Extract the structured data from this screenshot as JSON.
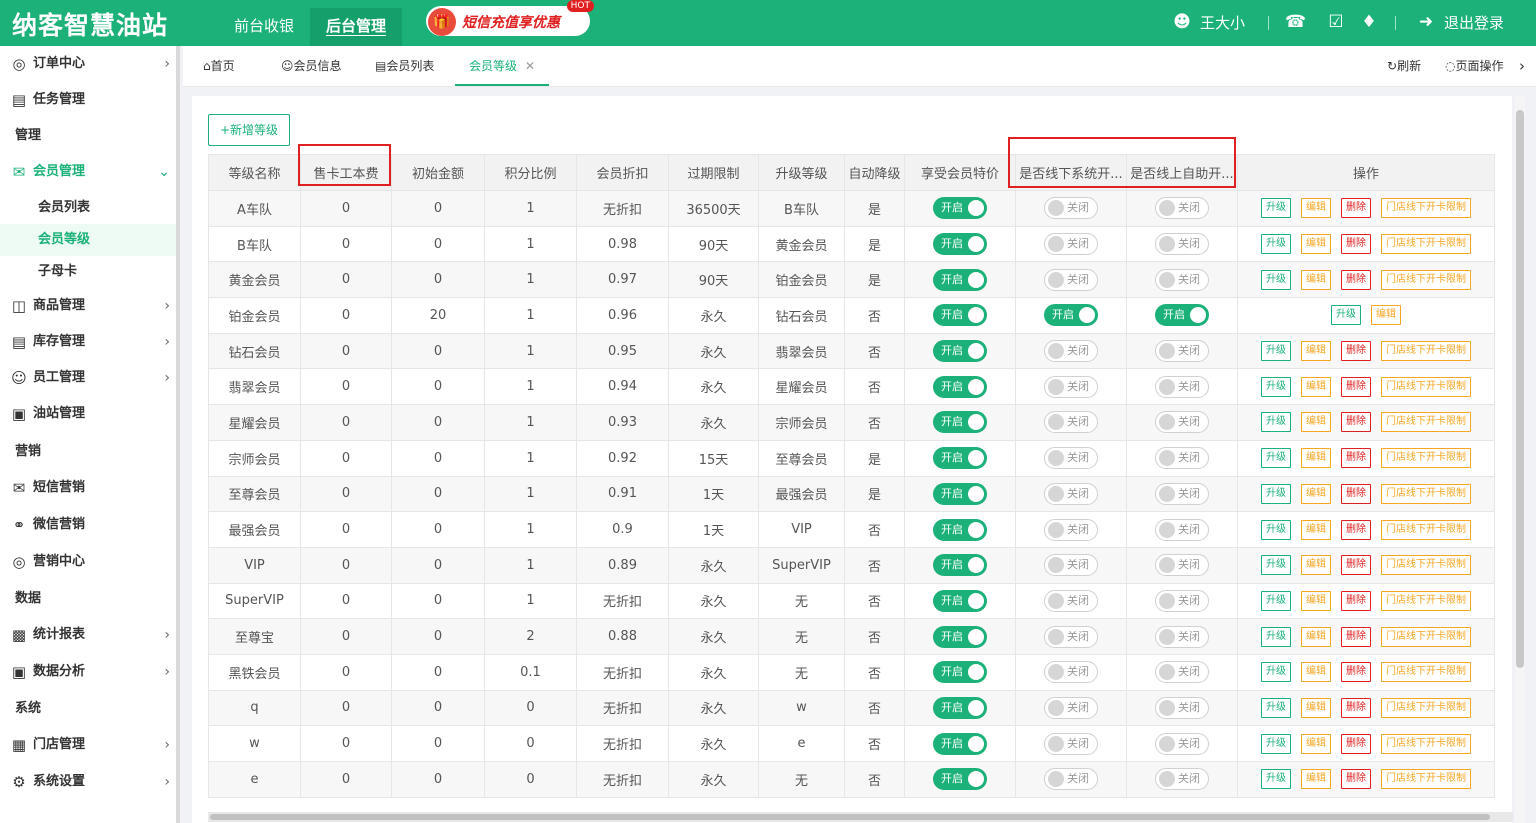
{
  "header": {
    "logo": "纳客智慧油站",
    "nav": [
      "前台收银",
      "后台管理"
    ],
    "promo": "短信充值享优惠",
    "promo_badge": "HOT",
    "user": "王大小",
    "logout": "退出登录"
  },
  "sidebar": {
    "items": [
      {
        "label": "订单中心",
        "icon": "globe-icon"
      },
      {
        "label": "任务管理",
        "icon": "task-icon"
      },
      {
        "label": "管理",
        "section": true
      },
      {
        "label": "会员管理",
        "icon": "member-icon"
      },
      {
        "label": "会员列表",
        "sub": true
      },
      {
        "label": "会员等级",
        "sub": true
      },
      {
        "label": "子母卡",
        "sub": true
      },
      {
        "label": "商品管理",
        "icon": "goods-icon"
      },
      {
        "label": "库存管理",
        "icon": "stock-icon"
      },
      {
        "label": "员工管理",
        "icon": "staff-icon"
      },
      {
        "label": "油站管理",
        "icon": "station-icon"
      },
      {
        "label": "营销",
        "section": true
      },
      {
        "label": "短信营销",
        "icon": "mail-icon"
      },
      {
        "label": "微信营销",
        "icon": "wechat-icon"
      },
      {
        "label": "营销中心",
        "icon": "target-icon"
      },
      {
        "label": "数据",
        "section": true
      },
      {
        "label": "统计报表",
        "icon": "report-icon"
      },
      {
        "label": "数据分析",
        "icon": "analysis-icon"
      },
      {
        "label": "系统",
        "section": true
      },
      {
        "label": "门店管理",
        "icon": "store-icon"
      },
      {
        "label": "系统设置",
        "icon": "settings-icon"
      }
    ]
  },
  "tabs": {
    "items": [
      "首页",
      "会员信息",
      "会员列表",
      "会员等级"
    ],
    "refresh": "刷新",
    "page_ops": "页面操作"
  },
  "toolbar": {
    "add_label": "+新增等级"
  },
  "table": {
    "headers": [
      "等级名称",
      "售卡工本费",
      "初始金额",
      "积分比例",
      "会员折扣",
      "过期限制",
      "升级等级",
      "自动降级",
      "享受会员特价",
      "是否线下系统开...",
      "是否线上自助开...",
      "操作"
    ],
    "rows": [
      [
        "A车队",
        "0",
        "0",
        "1",
        "无折扣",
        "36500天",
        "B车队",
        "是",
        "开启",
        "关闭",
        "关闭"
      ],
      [
        "B车队",
        "0",
        "0",
        "1",
        "0.98",
        "90天",
        "黄金会员",
        "是",
        "开启",
        "关闭",
        "关闭"
      ],
      [
        "黄金会员",
        "0",
        "0",
        "1",
        "0.97",
        "90天",
        "铂金会员",
        "是",
        "开启",
        "关闭",
        "关闭"
      ],
      [
        "铂金会员",
        "0",
        "20",
        "1",
        "0.96",
        "永久",
        "钻石会员",
        "否",
        "开启",
        "开启",
        "开启"
      ],
      [
        "钻石会员",
        "0",
        "0",
        "1",
        "0.95",
        "永久",
        "翡翠会员",
        "否",
        "开启",
        "关闭",
        "关闭"
      ],
      [
        "翡翠会员",
        "0",
        "0",
        "1",
        "0.94",
        "永久",
        "星耀会员",
        "否",
        "开启",
        "关闭",
        "关闭"
      ],
      [
        "星耀会员",
        "0",
        "0",
        "1",
        "0.93",
        "永久",
        "宗师会员",
        "否",
        "开启",
        "关闭",
        "关闭"
      ],
      [
        "宗师会员",
        "0",
        "0",
        "1",
        "0.92",
        "15天",
        "至尊会员",
        "是",
        "开启",
        "关闭",
        "关闭"
      ],
      [
        "至尊会员",
        "0",
        "0",
        "1",
        "0.91",
        "1天",
        "最强会员",
        "是",
        "开启",
        "关闭",
        "关闭"
      ],
      [
        "最强会员",
        "0",
        "0",
        "1",
        "0.9",
        "1天",
        "VIP",
        "否",
        "开启",
        "关闭",
        "关闭"
      ],
      [
        "VIP",
        "0",
        "0",
        "1",
        "0.89",
        "永久",
        "SuperVIP",
        "否",
        "开启",
        "关闭",
        "关闭"
      ],
      [
        "SuperVIP",
        "0",
        "0",
        "1",
        "无折扣",
        "永久",
        "无",
        "否",
        "开启",
        "关闭",
        "关闭"
      ],
      [
        "至尊宝",
        "0",
        "0",
        "2",
        "0.88",
        "永久",
        "无",
        "否",
        "开启",
        "关闭",
        "关闭"
      ],
      [
        "黑铁会员",
        "0",
        "0",
        "0.1",
        "无折扣",
        "永久",
        "无",
        "否",
        "开启",
        "关闭",
        "关闭"
      ],
      [
        "q",
        "0",
        "0",
        "0",
        "无折扣",
        "永久",
        "w",
        "否",
        "开启",
        "关闭",
        "关闭"
      ],
      [
        "w",
        "0",
        "0",
        "0",
        "无折扣",
        "永久",
        "e",
        "否",
        "开启",
        "关闭",
        "关闭"
      ],
      [
        "e",
        "0",
        "0",
        "0",
        "无折扣",
        "永久",
        "无",
        "否",
        "开启",
        "关闭",
        "关闭"
      ]
    ],
    "actions": {
      "upgrade": "升级",
      "edit": "编辑",
      "delete": "删除",
      "store_limit": "门店线下开卡限制"
    }
  },
  "colors": {
    "brand": "#1bb179",
    "highlight_box": "#e02020",
    "edit": "#f5a623",
    "delete": "#e02020"
  }
}
